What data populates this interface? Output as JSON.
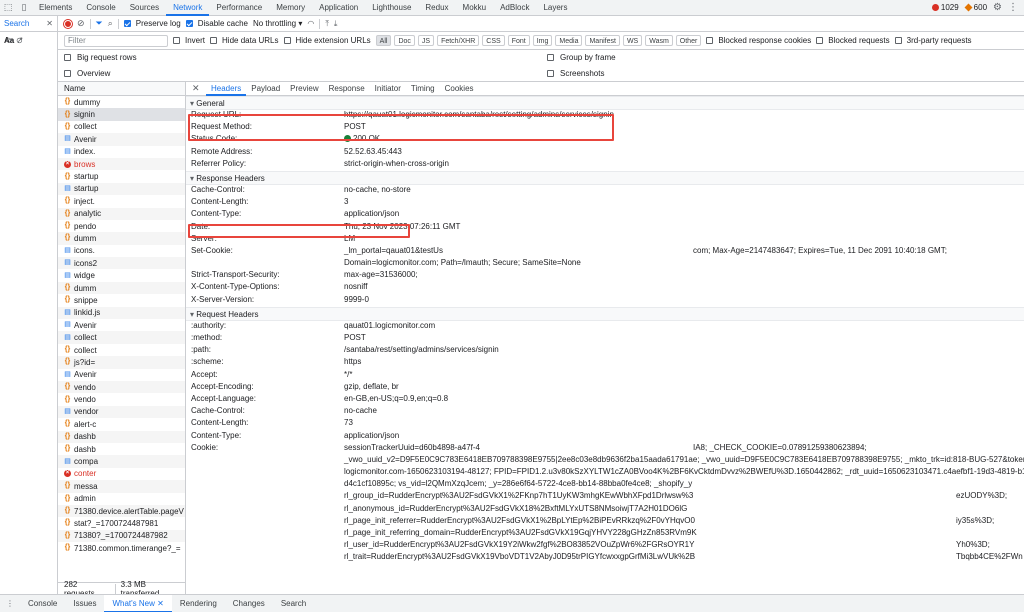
{
  "top_tabs": [
    "Elements",
    "Console",
    "Sources",
    "Network",
    "Performance",
    "Memory",
    "Application",
    "Lighthouse",
    "Redux",
    "Mokku",
    "AdBlock",
    "Layers"
  ],
  "active_tab": "Network",
  "counts": {
    "errors": "1029",
    "warnings": "600"
  },
  "search_pane": {
    "tab_label": "Search",
    "case_label": "Aa",
    "regex_label": ".*"
  },
  "toolbar": {
    "preserve_log": "Preserve log",
    "disable_cache": "Disable cache",
    "throttle": "No throttling"
  },
  "filter": {
    "placeholder": "Filter",
    "invert": "Invert",
    "hide_data": "Hide data URLs",
    "hide_ext": "Hide extension URLs",
    "types": [
      "All",
      "Doc",
      "JS",
      "Fetch/XHR",
      "CSS",
      "Font",
      "Img",
      "Media",
      "Manifest",
      "WS",
      "Wasm",
      "Other"
    ],
    "blocked_cookies": "Blocked response cookies",
    "blocked_requests": "Blocked requests",
    "third_party": "3rd-party requests"
  },
  "options": {
    "big_rows": "Big request rows",
    "overview": "Overview",
    "group_frame": "Group by frame",
    "screenshots": "Screenshots"
  },
  "request_list": {
    "header": "Name",
    "rows": [
      {
        "name": "dummy",
        "type": "xhr"
      },
      {
        "name": "signin",
        "type": "xhr"
      },
      {
        "name": "collect",
        "type": "xhr"
      },
      {
        "name": "Avenir",
        "type": "doc"
      },
      {
        "name": "index.",
        "type": "doc"
      },
      {
        "name": "brows",
        "type": "err"
      },
      {
        "name": "startup",
        "type": "xhr"
      },
      {
        "name": "startup",
        "type": "doc"
      },
      {
        "name": "inject.",
        "type": "xhr"
      },
      {
        "name": "analytic",
        "type": "xhr"
      },
      {
        "name": "pendo",
        "type": "xhr"
      },
      {
        "name": "dumm",
        "type": "xhr"
      },
      {
        "name": "icons.",
        "type": "doc"
      },
      {
        "name": "icons2",
        "type": "doc"
      },
      {
        "name": "widge",
        "type": "doc"
      },
      {
        "name": "dumm",
        "type": "xhr"
      },
      {
        "name": "snippe",
        "type": "xhr"
      },
      {
        "name": "linkid.js",
        "type": "doc"
      },
      {
        "name": "Avenir",
        "type": "doc"
      },
      {
        "name": "collect",
        "type": "doc"
      },
      {
        "name": "collect",
        "type": "xhr"
      },
      {
        "name": "js?id=",
        "type": "xhr"
      },
      {
        "name": "Avenir",
        "type": "doc"
      },
      {
        "name": "vendo",
        "type": "xhr"
      },
      {
        "name": "vendo",
        "type": "xhr"
      },
      {
        "name": "vendor",
        "type": "doc"
      },
      {
        "name": "alert-c",
        "type": "xhr"
      },
      {
        "name": "dashb",
        "type": "xhr"
      },
      {
        "name": "dashb",
        "type": "xhr"
      },
      {
        "name": "compa",
        "type": "doc"
      },
      {
        "name": "conter",
        "type": "err"
      },
      {
        "name": "messa",
        "type": "xhr"
      },
      {
        "name": "admin",
        "type": "xhr"
      },
      {
        "name": "71380.device.alertTable.pageV",
        "type": "xhr"
      },
      {
        "name": "stat?_=1700724487981",
        "type": "xhr"
      },
      {
        "name": "71380?_=1700724487982",
        "type": "xhr"
      },
      {
        "name": "71380.common.timerange?_=",
        "type": "xhr"
      }
    ],
    "status": {
      "requests": "282 requests",
      "transferred": "3.3 MB transferred"
    }
  },
  "detail_tabs": [
    "Headers",
    "Payload",
    "Preview",
    "Response",
    "Initiator",
    "Timing",
    "Cookies"
  ],
  "general": {
    "title": "General",
    "rows": [
      {
        "k": "Request URL:",
        "v": "https://qauat01.logicmonitor.com/santaba/rest/setting/admins/services/signin"
      },
      {
        "k": "Request Method:",
        "v": "POST"
      },
      {
        "k": "Status Code:",
        "v": "200 OK"
      },
      {
        "k": "Remote Address:",
        "v": "52.52.63.45:443"
      },
      {
        "k": "Referrer Policy:",
        "v": "strict-origin-when-cross-origin"
      }
    ]
  },
  "response_headers": {
    "title": "Response Headers",
    "rows": [
      {
        "k": "Cache-Control:",
        "v": "no-cache, no-store"
      },
      {
        "k": "Content-Length:",
        "v": "3"
      },
      {
        "k": "Content-Type:",
        "v": "application/json"
      },
      {
        "k": "Date:",
        "v": "Thu, 23 Nov 2023 07:26:11 GMT"
      },
      {
        "k": "Server:",
        "v": "LM"
      },
      {
        "k": "Set-Cookie:",
        "v": "_lm_portal=qauat01&testUs",
        "v2": "com; Max-Age=2147483647; Expires=Tue, 11 Dec 2091 10:40:18 GMT;"
      },
      {
        "k": "",
        "v": "Domain=logicmonitor.com; Path=/lmauth; Secure; SameSite=None"
      },
      {
        "k": "Strict-Transport-Security:",
        "v": "max-age=31536000;"
      },
      {
        "k": "X-Content-Type-Options:",
        "v": "nosniff"
      },
      {
        "k": "X-Server-Version:",
        "v": "9999-0"
      }
    ]
  },
  "request_headers": {
    "title": "Request Headers",
    "rows": [
      {
        "k": ":authority:",
        "v": "qauat01.logicmonitor.com"
      },
      {
        "k": ":method:",
        "v": "POST"
      },
      {
        "k": ":path:",
        "v": "/santaba/rest/setting/admins/services/signin"
      },
      {
        "k": ":scheme:",
        "v": "https"
      },
      {
        "k": "Accept:",
        "v": "*/*"
      },
      {
        "k": "Accept-Encoding:",
        "v": "gzip, deflate, br"
      },
      {
        "k": "Accept-Language:",
        "v": "en-GB,en-US;q=0.9,en;q=0.8"
      },
      {
        "k": "Cache-Control:",
        "v": "no-cache"
      },
      {
        "k": "Content-Length:",
        "v": "73"
      },
      {
        "k": "Content-Type:",
        "v": "application/json"
      },
      {
        "k": "Cookie:",
        "v": "sessionTrackerUuid=d60b4898-a47f-4",
        "v2": "IA8; _CHECK_COOKIE=0.07891259380623894;"
      },
      {
        "k": "",
        "v": "_vwo_uuid_v2=D9F5E0C9C783E6418EB709788398E9755|2ee8c03e8db9636f2ba15aada61791ae; _vwo_uuid=D9F5E0C9C783E6418EB709788398E9755; _mkto_trk=id:818-BUG-527&token:_mch-"
      },
      {
        "k": "",
        "v": "logicmonitor.com-1650623103194-48127; FPID=FPID1.2.u3v80kSzXYLTW1cZA0BVoo4K%2BF6KvCktdmDvvz%2BWEfU%3D.1650442862; _rdt_uuid=1650623103471.c4aefbf1-19d3-4819-b18f-"
      },
      {
        "k": "",
        "v": "d4c1cf10895c; vs_vid=l2QMmXzqJcem; _y=286e6f64-5722-4ce8-bb14-88bba0fe4ce8; _shopify_y"
      },
      {
        "k": "",
        "v": "rl_group_id=RudderEncrypt%3AU2FsdGVkX1%2FKnp7hT1UyKW3mhgKEwWbhXFpd1Drlwsw%3",
        "v3": "ezUODY%3D;"
      },
      {
        "k": "",
        "v": "rl_anonymous_id=RudderEncrypt%3AU2FsdGVkX18%2BxftMLYxUTS8NMsoiwjT7A2H01DO6lG"
      },
      {
        "k": "",
        "v": "rl_page_init_referrer=RudderEncrypt%3AU2FsdGVkX1%2BpLYtEp%2BiPEvRRkzq%2F0vYHqvO0",
        "v3": "iy35s%3D;"
      },
      {
        "k": "",
        "v": "rl_page_init_referring_domain=RudderEncrypt%3AU2FsdGVkX19GqjYHVY228gGHzZn853RVm9K"
      },
      {
        "k": "",
        "v": "rl_user_id=RudderEncrypt%3AU2FsdGVkX19Y2iWkw2fgf%2BO83852VOuZpWr6%2FGRsOYR1Y",
        "v3": "Yh0%3D;"
      },
      {
        "k": "",
        "v": "rl_trait=RudderEncrypt%3AU2FsdGVkX19VboVDT1V2AbyJ0D95trPIGYfcwxxgpGrfMi3LwVUk%2B",
        "v3": "Tbqbb4CE%2FWn"
      }
    ]
  },
  "drawer_tabs": [
    "Console",
    "Issues",
    "What's New",
    "Rendering",
    "Changes",
    "Search"
  ],
  "active_drawer_tab": "What's New"
}
